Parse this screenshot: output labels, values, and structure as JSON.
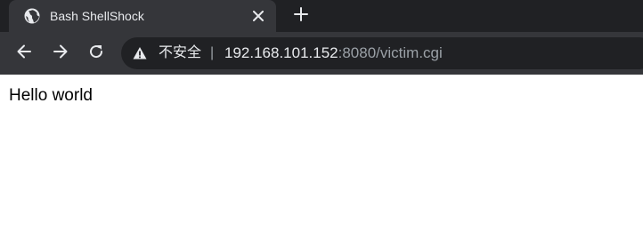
{
  "tab": {
    "title": "Bash ShellShock",
    "icon": "globe-icon"
  },
  "toolbar": {
    "back_icon": "back-arrow-icon",
    "forward_icon": "forward-arrow-icon",
    "reload_icon": "reload-icon"
  },
  "omnibox": {
    "security_icon": "warning-icon",
    "security_label": "不安全",
    "separator": "|",
    "url_host": "192.168.101.152",
    "url_path": ":8080/victim.cgi"
  },
  "page": {
    "body_text": "Hello world"
  },
  "colors": {
    "tabstrip_bg": "#202124",
    "active_tab_bg": "#35363a",
    "omnibox_bg": "#202124",
    "text_light": "#e8eaed",
    "text_dim": "#9aa0a6"
  }
}
